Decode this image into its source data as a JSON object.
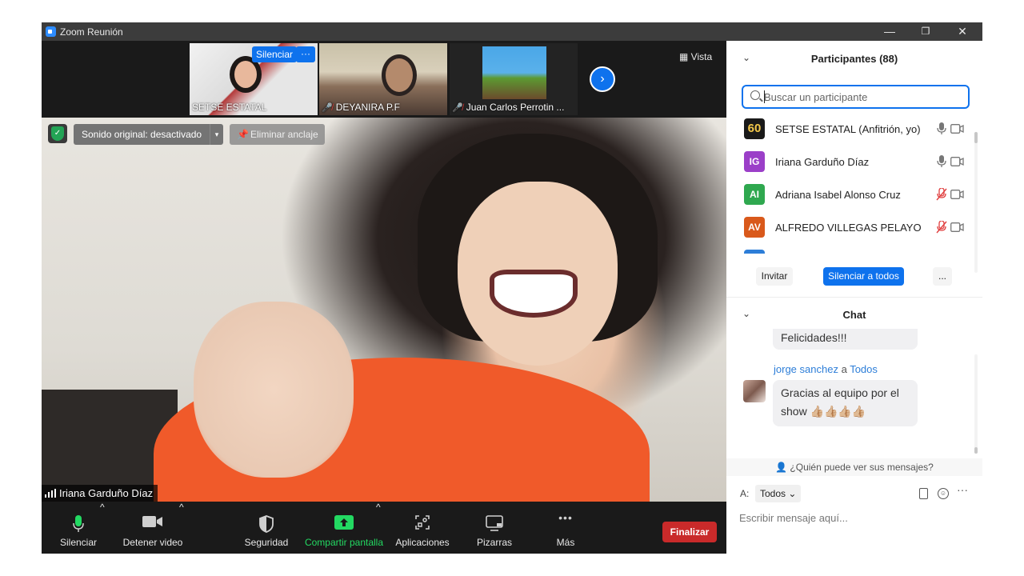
{
  "window": {
    "title": "Zoom Reunión",
    "minimize_glyph": "—",
    "restore_glyph": "❐",
    "close_glyph": "✕"
  },
  "thumbnails": [
    {
      "name": "SETSE ESTATAL",
      "muted": false,
      "overlay_mute_label": "Silenciar",
      "overlay_more_label": "···"
    },
    {
      "name": "DEYANIRA P.F",
      "muted": true
    },
    {
      "name": "Juan Carlos Perrotin ...",
      "muted": true
    }
  ],
  "strip": {
    "next_glyph": "›",
    "view_label": "Vista",
    "view_icon": "grid-icon"
  },
  "main_video": {
    "original_sound_label": "Sonido original: desactivado",
    "dropdown_glyph": "▾",
    "unpin_label": "Eliminar anclaje",
    "speaker_name": "Iriana Garduño Díaz"
  },
  "toolbar": {
    "mute_label": "Silenciar",
    "video_label": "Detener video",
    "security_label": "Seguridad",
    "share_label": "Compartir pantalla",
    "apps_label": "Aplicaciones",
    "whiteboards_label": "Pizarras",
    "more_label": "Más",
    "more_glyph": "•••",
    "caret_glyph": "^",
    "end_label": "Finalizar",
    "colors": {
      "share": "#23d962",
      "end": "#c92a2a"
    }
  },
  "participants": {
    "title": "Participantes (88)",
    "collapse_glyph": "⌄",
    "search_placeholder": "Buscar un participante",
    "list": [
      {
        "initials": "60",
        "name": "SETSE ESTATAL (Anfitrión, yo)",
        "color": "#1a1a1a",
        "mic": "on",
        "camera": "off"
      },
      {
        "initials": "IG",
        "name": "Iriana Garduño Díaz",
        "color": "#9b3fc8",
        "mic": "on",
        "camera": "off"
      },
      {
        "initials": "AI",
        "name": "Adriana Isabel Alonso Cruz",
        "color": "#2fa84f",
        "mic": "muted",
        "camera": "off"
      },
      {
        "initials": "AV",
        "name": "ALFREDO VILLEGAS PELAYO",
        "color": "#d9591b",
        "mic": "muted",
        "camera": "off"
      },
      {
        "initials": "",
        "name": "",
        "color": "#2d7ed8",
        "mic": "muted",
        "camera": "off"
      }
    ],
    "invite_label": "Invitar",
    "mute_all_label": "Silenciar a todos",
    "more_label": "..."
  },
  "chat": {
    "title": "Chat",
    "collapse_glyph": "⌄",
    "previous_message": "Felicidades!!!",
    "sender_name": "jorge sanchez",
    "sender_connector": "a",
    "recipient": "Todos",
    "message": "Gracias al equipo por el show 👍🏼👍🏼👍🏼👍🏼",
    "who_can_see": "¿Quién puede ver sus mensajes?",
    "to_label": "A:",
    "to_value": "Todos",
    "to_glyph": "⌄",
    "more_glyph": "···",
    "input_placeholder": "Escribir mensaje aquí..."
  }
}
